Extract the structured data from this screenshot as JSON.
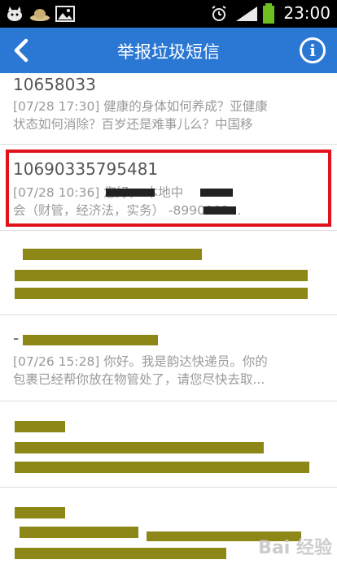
{
  "status": {
    "time": "23:00",
    "icons": [
      "cat-notification-icon",
      "hat-notification-icon",
      "image-notification-icon",
      "alarm-icon",
      "signal-icon",
      "battery-icon"
    ]
  },
  "header": {
    "title": "举报垃圾短信",
    "back_icon": "chevron-left-icon",
    "info_icon": "info-icon",
    "info_glyph": "i",
    "bar_color": "#2b78d4"
  },
  "messages": [
    {
      "sender": "10658033",
      "preview_lines": [
        "[07/28 17:30] 健康的身体如何养成？亚健康",
        "状态如何消除？百岁还是难事儿么？中国移"
      ]
    },
    {
      "sender": "10690335795481",
      "preview_lines": [
        "[07/28 10:36]            您好，        本地中",
        "会（财管，经济法，实务）          -8990002..."
      ],
      "selected": true
    },
    {
      "sender": "",
      "preview_lines": [
        "",
        ""
      ],
      "redacted": true
    },
    {
      "sender": "-",
      "preview_lines": [
        "[07/26 15:28] 你好。我是韵达快递员。你的",
        "包裹已经帮你放在物管处了，请您尽快去取..."
      ]
    },
    {
      "sender": "",
      "preview_lines": [
        "",
        ""
      ],
      "redacted": true
    },
    {
      "sender": "",
      "preview_lines": [
        "",
        ""
      ],
      "redacted": true
    }
  ],
  "watermark": "Bai 经验",
  "colors": {
    "highlight": "#e0121b",
    "redaction": "#8c8717"
  }
}
